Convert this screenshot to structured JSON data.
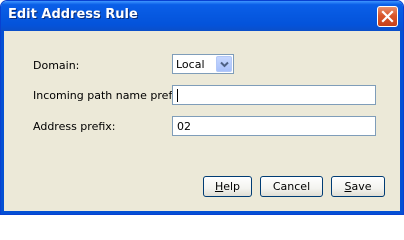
{
  "window": {
    "title": "Edit Address Rule"
  },
  "form": {
    "domain_label": "Domain:",
    "domain_value": "Local",
    "incoming_prefix_label": "Incoming path name prefix:",
    "incoming_prefix_value": "",
    "address_prefix_label": "Address prefix:",
    "address_prefix_value": "02"
  },
  "buttons": {
    "help": {
      "first": "H",
      "rest": "elp"
    },
    "cancel": "Cancel",
    "save": {
      "first": "S",
      "rest": "ave"
    }
  },
  "icons": {
    "close": "close-icon",
    "dropdown": "chevron-down-icon"
  },
  "colors": {
    "titlebar": "#0658e0",
    "dialog_bg": "#ece9d8",
    "close_button": "#d9562b"
  }
}
